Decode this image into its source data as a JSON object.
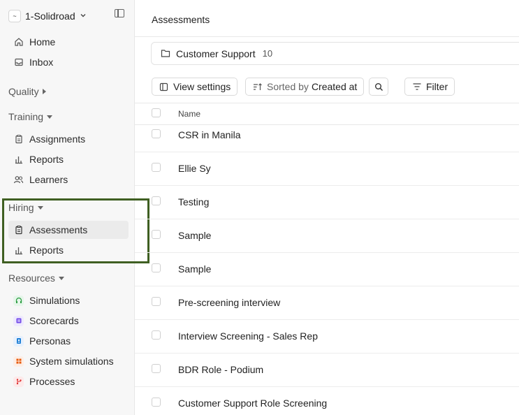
{
  "workspace": {
    "name": "1-Solidroad",
    "logo": "~"
  },
  "nav_top": [
    {
      "label": "Home",
      "icon": "home-icon"
    },
    {
      "label": "Inbox",
      "icon": "inbox-icon"
    }
  ],
  "sections": {
    "quality": "Quality",
    "training": "Training",
    "hiring": "Hiring",
    "resources": "Resources"
  },
  "training_items": [
    "Assignments",
    "Reports",
    "Learners"
  ],
  "hiring_items": [
    "Assessments",
    "Reports"
  ],
  "resources_items": [
    {
      "label": "Simulations",
      "color": "#2f9e44"
    },
    {
      "label": "Scorecards",
      "color": "#7048e8"
    },
    {
      "label": "Personas",
      "color": "#1c7ed6"
    },
    {
      "label": "System simulations",
      "color": "#e8590c"
    },
    {
      "label": "Processes",
      "color": "#e03131"
    }
  ],
  "main": {
    "title": "Assessments",
    "folder": {
      "name": "Customer Support",
      "count": "10"
    },
    "toolbar": {
      "view_settings": "View settings",
      "sorted_by_label": "Sorted by",
      "sorted_by_value": "Created at",
      "filter": "Filter"
    },
    "table": {
      "column_name": "Name",
      "rows": [
        "CSR in Manila",
        "Ellie Sy",
        "Testing",
        "Sample",
        "Sample",
        "Pre-screening interview",
        "Interview Screening - Sales Rep",
        "BDR Role - Podium",
        "Customer Support Role Screening"
      ]
    }
  }
}
